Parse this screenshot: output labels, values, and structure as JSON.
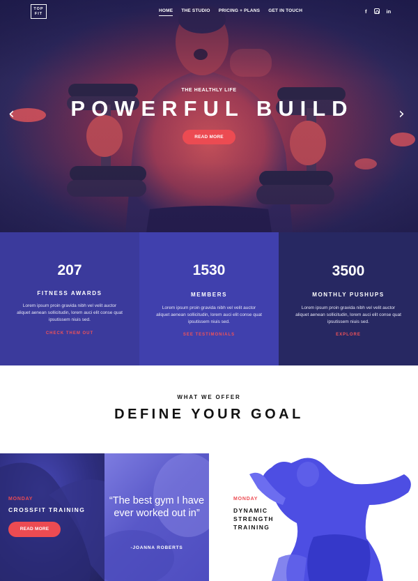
{
  "brand": {
    "logo_line1": "TOP",
    "logo_line2": "FIT"
  },
  "nav": {
    "items": [
      "HOME",
      "THE STUDIO",
      "PRICING + PLANS",
      "GET IN TOUCH"
    ],
    "active": "HOME"
  },
  "social": {
    "facebook": "f",
    "linkedin": "in"
  },
  "hero": {
    "kicker": "THE HEALTHLY LIFE",
    "headline": "POWERFUL BUILD",
    "cta": "READ MORE",
    "prev_arrow": "‹",
    "next_arrow": "›"
  },
  "stats": [
    {
      "value": "207",
      "label": "FITNESS AWARDS",
      "desc": "Lorem ipsum proin gravida nibh vel velit auctor aliquet aenean sollicitudin, lorem auci elit conse quat ipsutissem niuis sed.",
      "link": "CHECK THEM OUT"
    },
    {
      "value": "1530",
      "label": "MEMBERS",
      "desc": "Lorem ipsum proin gravida nibh vel velit auctor aliquet aenean sollicitudin, lorem auci elit conse quat ipsutissem niuis sed.",
      "link": "SEE TESTIMONIALS"
    },
    {
      "value": "3500",
      "label": "MONTHLY PUSHUPS",
      "desc": "Lorem ipsum proin gravida nibh vel velit auctor aliquet aenean sollicitudin, lorem auci elit conse quat ipsutissem niuis sed.",
      "link": "EXPLORE"
    }
  ],
  "offer": {
    "kicker": "WHAT WE OFFER",
    "title": "DEFINE YOUR GOAL"
  },
  "cards": {
    "crossfit": {
      "day": "MONDAY",
      "title": "CROSSFIT TRAINING",
      "cta": "READ MORE"
    },
    "testimonial": {
      "quote": "“The best gym I have ever worked out in”",
      "author": "-JOANNA ROBERTS"
    },
    "dynamic": {
      "day": "MONDAY",
      "title": "DYNAMIC STRENGTH TRAINING"
    }
  },
  "colors": {
    "accent": "#ec4b52",
    "stat1": "#3b3a9c",
    "stat2": "#4040ad",
    "stat3": "#272862",
    "hero_dark": "#221f4d"
  },
  "icons": {
    "prev": "chevron-left-icon",
    "next": "chevron-right-icon",
    "facebook": "facebook-icon",
    "instagram": "instagram-icon",
    "linkedin": "linkedin-icon"
  }
}
